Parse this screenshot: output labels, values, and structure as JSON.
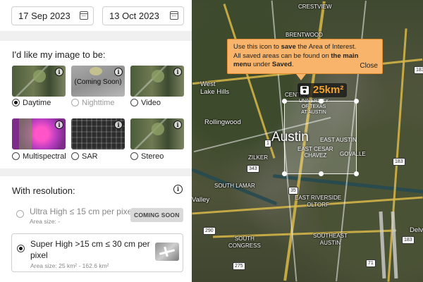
{
  "dates": {
    "start": "17 Sep 2023",
    "end": "13 Oct 2023"
  },
  "imagery": {
    "title": "I'd like my image to be:",
    "options": [
      {
        "label": "Daytime",
        "selected": true,
        "disabled": false,
        "overlay": ""
      },
      {
        "label": "Nighttime",
        "selected": false,
        "disabled": true,
        "overlay": "(Coming Soon)"
      },
      {
        "label": "Video",
        "selected": false,
        "disabled": false,
        "overlay": ""
      },
      {
        "label": "Multispectral",
        "selected": false,
        "disabled": false,
        "overlay": ""
      },
      {
        "label": "SAR",
        "selected": false,
        "disabled": false,
        "overlay": ""
      },
      {
        "label": "Stereo",
        "selected": false,
        "disabled": false,
        "overlay": ""
      }
    ],
    "info_glyph": "i"
  },
  "resolution": {
    "title": "With resolution:",
    "options": [
      {
        "title": "Ultra High ≤ 15 cm per pixel",
        "area": "Area size: -",
        "badge": "COMING SOON",
        "selected": false,
        "disabled": true
      },
      {
        "title": "Super High >15 cm ≤ 30 cm per pixel",
        "area": "Area size: 25 km² - 162.6 km²",
        "badge": "",
        "selected": true,
        "disabled": false
      }
    ]
  },
  "tooltip": {
    "line1_pre": "Use this icon to ",
    "line1_bold": "save",
    "line1_post": " the Area of Interest.",
    "line2_pre": "All saved areas can be found on ",
    "line2_bold": "the main",
    "line3_bold1": "menu",
    "line3_mid": " under ",
    "line3_bold2": "Saved",
    "line3_post": ".",
    "close": "Close"
  },
  "aoi": {
    "area": "25km²"
  },
  "map": {
    "city": "Austin",
    "labels": {
      "crestview": "CRESTVIEW",
      "brentwood": "BRENTWOOD",
      "west_lake_hills": "West\nLake Hills",
      "central": "CENTRAL",
      "ut": "UNIVERSITY\nOF TEXAS\nAT AUSTIN",
      "rollingwood": "Rollingwood",
      "east_austin": "EAST AUSTIN",
      "east_cesar_chavez": "EAST CESAR\nCHAVEZ",
      "govalle": "GOVALLE",
      "zilker": "ZILKER",
      "south_lamar": "SOUTH LAMAR",
      "valley": "Valley",
      "east_riverside": "EAST RIVERSIDE\nOLTORF",
      "south_congress": "SOUTH\nCONGRESS",
      "southeast_austin": "SOUTHEAST\nAUSTIN",
      "delv": "Delv"
    },
    "shields": {
      "s183a": "183",
      "s1": "1",
      "s343": "343",
      "s35": "35",
      "s183b": "183",
      "s290": "290",
      "s275": "275",
      "s71": "71",
      "s183c": "183"
    }
  }
}
